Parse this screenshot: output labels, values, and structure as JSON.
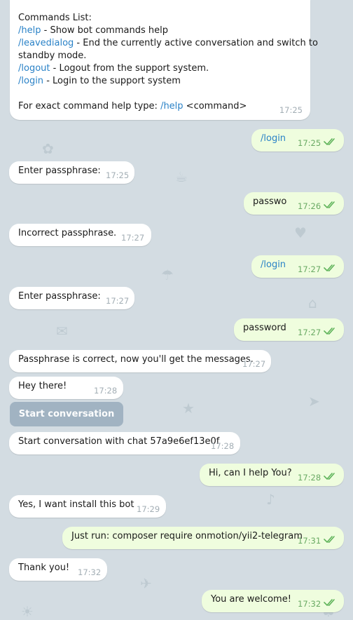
{
  "commands_card": {
    "title": "Commands List:",
    "items": [
      {
        "cmd": "/help",
        "desc": " - Show bot commands help"
      },
      {
        "cmd": "/leavedialog",
        "desc": " - End the currently active conversation and switch to"
      },
      {
        "cmd": "",
        "desc": "standby mode."
      },
      {
        "cmd": "/logout",
        "desc": " - Logout from the support system."
      },
      {
        "cmd": "/login",
        "desc": " - Login to the support system"
      }
    ],
    "footer_prefix": "For exact command help type: ",
    "footer_cmd": "/help",
    "footer_suffix": " <command>",
    "time": "17:25"
  },
  "messages": [
    {
      "dir": "out",
      "text": "/login",
      "link": true,
      "time": "17:25"
    },
    {
      "dir": "in",
      "text": "Enter passphrase:",
      "time": "17:25"
    },
    {
      "dir": "out",
      "text": "passwo",
      "time": "17:26"
    },
    {
      "dir": "in",
      "text": "Incorrect passphrase.",
      "time": "17:27"
    },
    {
      "dir": "out",
      "text": "/login",
      "link": true,
      "time": "17:27"
    },
    {
      "dir": "in",
      "text": "Enter passphrase:",
      "time": "17:27"
    },
    {
      "dir": "out",
      "text": "password",
      "time": "17:27"
    },
    {
      "dir": "in",
      "text": "Passphrase is correct, now you'll get the messages.",
      "time": "17:27"
    },
    {
      "dir": "in",
      "text": "Hey there!",
      "time": "17:28"
    },
    {
      "dir": "in",
      "text": "Start conversation with chat 57a9e6ef13e0f",
      "time": "17:28"
    },
    {
      "dir": "out",
      "text": "Hi, can I help You?",
      "time": "17:28"
    },
    {
      "dir": "in",
      "text": "Yes, I want install this bot",
      "time": "17:29"
    },
    {
      "dir": "out",
      "text": "Just run: composer require onmotion/yii2-telegram",
      "time": "17:31"
    },
    {
      "dir": "in",
      "text": "Thank you!",
      "time": "17:32"
    },
    {
      "dir": "out",
      "text": "You are welcome!",
      "time": "17:32"
    }
  ],
  "inline_button": {
    "label": "Start conversation"
  },
  "colors": {
    "background": "#d3dce2",
    "incoming": "#ffffff",
    "outgoing": "#effdde",
    "link": "#2a82c7",
    "read_check": "#5fb35a",
    "button": "#9fb1c1"
  }
}
